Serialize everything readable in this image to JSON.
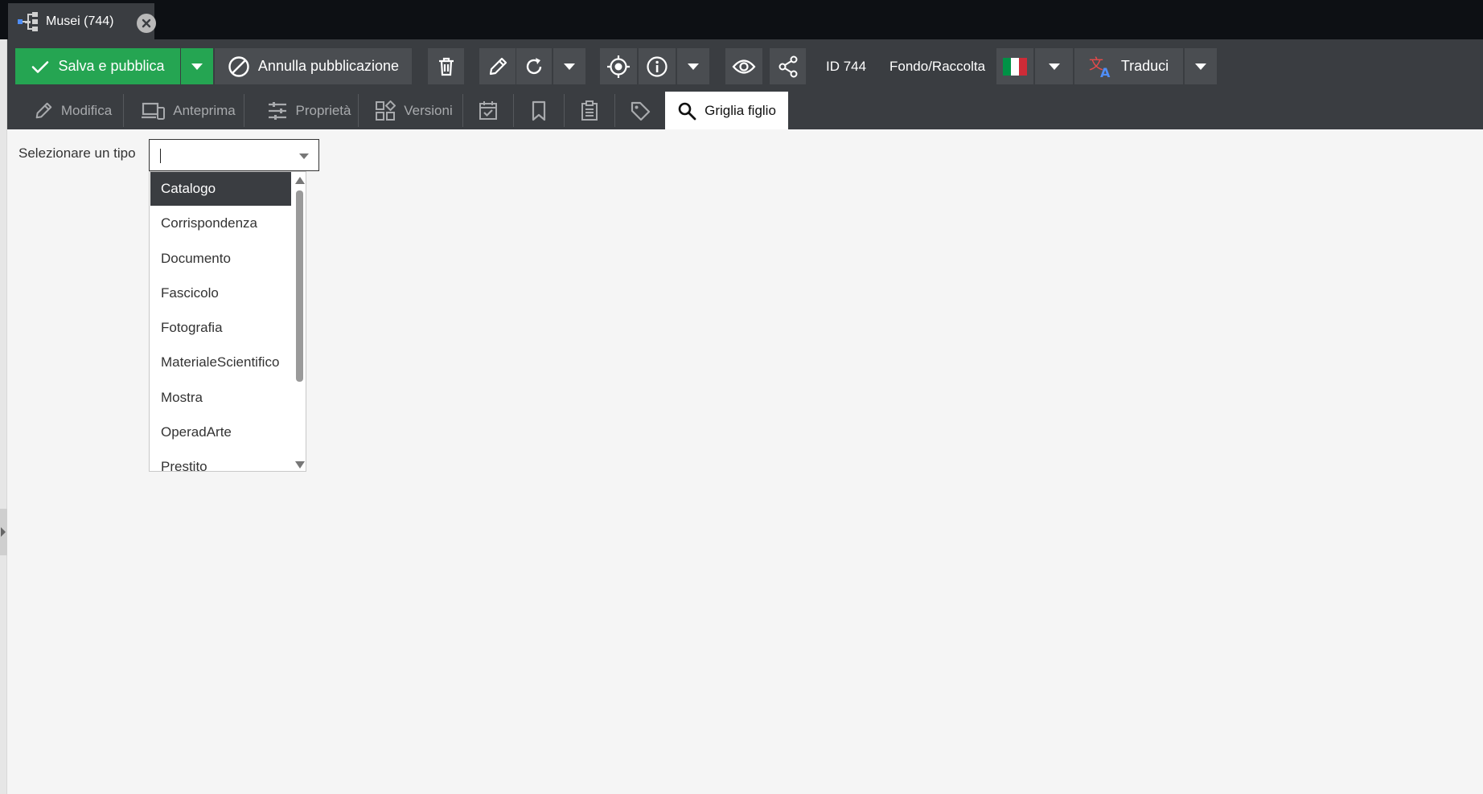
{
  "tab": {
    "title": "Musei (744)",
    "icon": "tree-structure-icon",
    "close_icon": "close-icon"
  },
  "toolbar": {
    "save_publish_label": "Salva e pubblica",
    "unpublish_label": "Annulla pubblicazione",
    "id_label": "ID 744",
    "type_label": "Fondo/Raccolta",
    "language_flag": "italy-flag-icon",
    "translate_label": "Traduci"
  },
  "nav": {
    "items": [
      {
        "label": "Modifica",
        "icon": "pencil-icon"
      },
      {
        "label": "Anteprima",
        "icon": "devices-icon"
      },
      {
        "label": "Proprietà",
        "icon": "sliders-icon"
      },
      {
        "label": "Versioni",
        "icon": "grid-shapes-icon"
      },
      {
        "label": "",
        "icon": "calendar-check-icon"
      },
      {
        "label": "",
        "icon": "bookmark-icon"
      },
      {
        "label": "",
        "icon": "clipboard-icon"
      },
      {
        "label": "",
        "icon": "tag-icon"
      },
      {
        "label": "Griglia figlio",
        "icon": "search-icon",
        "active": true
      }
    ]
  },
  "main": {
    "select_label": "Selezionare un tipo",
    "select_value": "",
    "options": [
      "Catalogo",
      "Corrispondenza",
      "Documento",
      "Fascicolo",
      "Fotografia",
      "MaterialeScientifico",
      "Mostra",
      "OperadArte",
      "Prestito"
    ],
    "highlighted_option": "Catalogo"
  },
  "colors": {
    "accent_green": "#25a552",
    "toolbar_bg": "#3a3d41",
    "button_bg": "#4a4d51",
    "tabbar_bg": "#0d1014",
    "content_bg": "#f5f5f5"
  }
}
